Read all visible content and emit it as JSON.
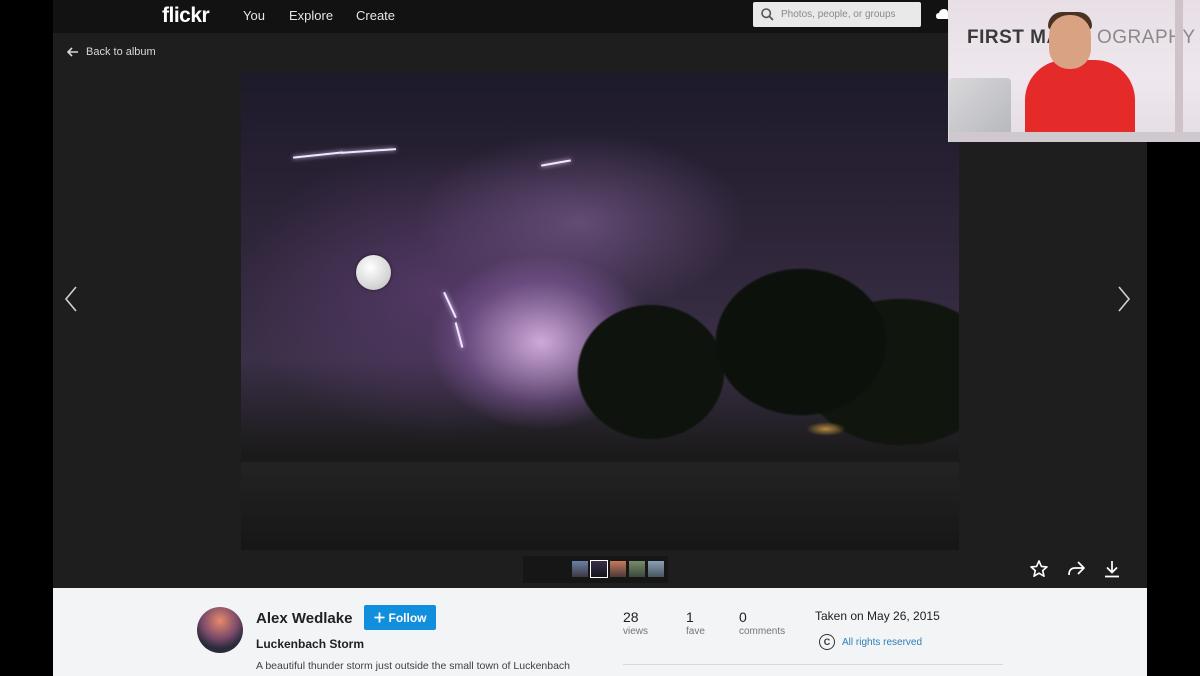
{
  "nav": {
    "logo": "flickr",
    "links": [
      "You",
      "Explore",
      "Create"
    ],
    "search_placeholder": "Photos, people, or groups"
  },
  "stage": {
    "back_label": "Back to album"
  },
  "photo_info": {
    "author": "Alex Wedlake",
    "follow_label": "Follow",
    "title": "Luckenbach Storm",
    "description": "A beautiful thunder storm just outside the small town of Luckenbach",
    "stats": [
      {
        "value": "28",
        "label": "views"
      },
      {
        "value": "1",
        "label": "fave"
      },
      {
        "value": "0",
        "label": "comments"
      }
    ],
    "taken": "Taken on May 26, 2015",
    "rights": "All rights reserved",
    "rights_symbol": "C"
  },
  "webcam": {
    "sign_left": "FIRST MAN",
    "sign_right": "OGRAPHY"
  },
  "colors": {
    "accent": "#128fdc",
    "link": "#2e7fb8",
    "nav_bg": "#121213",
    "stage_bg": "#1e1e1f"
  },
  "icons": [
    "search-icon",
    "cloud-upload-icon",
    "arrow-left-icon",
    "chevron-left-icon",
    "chevron-right-icon",
    "star-icon",
    "share-icon",
    "download-icon",
    "plus-icon",
    "copyright-icon"
  ]
}
